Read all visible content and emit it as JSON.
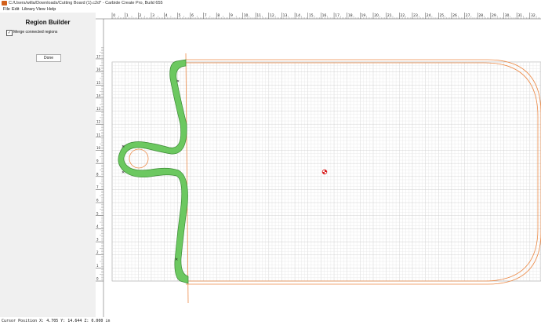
{
  "window": {
    "title": "C:/Users/willa/Downloads/Cutting Board (1).c2d* - Carbide Create Pro, Build 655"
  },
  "menu": {
    "items": [
      "File",
      "Edit",
      "Library",
      "View",
      "Help"
    ]
  },
  "sidebar": {
    "title": "Region Builder",
    "merge_label": "Merge connected regions",
    "merge_checked": true,
    "done_label": "Done"
  },
  "rulers": {
    "horizontal_ticks": [
      "0",
      "1",
      "2",
      "3",
      "4",
      "5",
      "6",
      "7",
      "8",
      "9",
      "10",
      "11",
      "12",
      "13",
      "14",
      "15",
      "16",
      "17",
      "18",
      "19",
      "20",
      "21",
      "22",
      "23",
      "24",
      "25",
      "26",
      "27",
      "28",
      "29",
      "30",
      "31",
      "32"
    ],
    "vertical_ticks": [
      "17",
      "16",
      "15",
      "14",
      "13",
      "12",
      "11",
      "10",
      "9",
      "8",
      "7",
      "6",
      "5",
      "4",
      "3",
      "2",
      "1",
      "0"
    ]
  },
  "colors": {
    "grid_minor": "#e6e6e6",
    "grid_major": "#c8c8c8",
    "outline_orange": "#ec8a47",
    "region_fill": "#6cc860",
    "region_stroke": "#3b8a34",
    "origin_marker": "#d81f1f"
  },
  "status": {
    "text": "Cursor Position X: 4.705 Y: 14.644 Z: 0.000 in"
  }
}
